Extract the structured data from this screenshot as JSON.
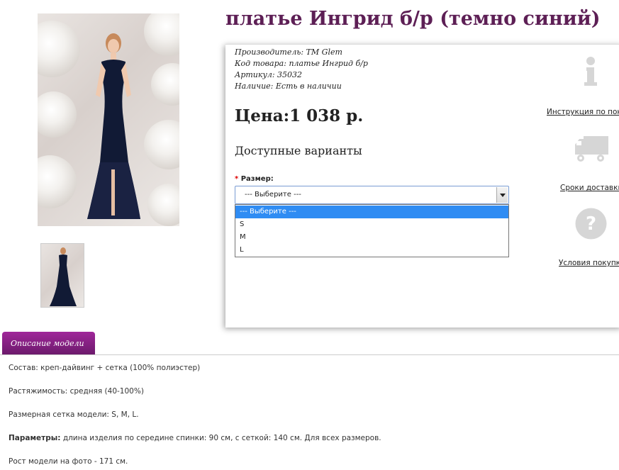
{
  "product": {
    "title": "платье Ингрид б/р (темно синий)"
  },
  "specs": {
    "manufacturer_label": "Производитель:",
    "manufacturer_value": "TM Glem",
    "code_label": "Код товара:",
    "code_value": "платье Ингрид б/р",
    "sku_label": "Артикул:",
    "sku_value": "35032",
    "availability_label": "Наличие:",
    "availability_value": "Есть в наличии"
  },
  "price": {
    "label": "Цена:",
    "value": "1 038 р."
  },
  "variants": {
    "title": "Доступные варианты",
    "required_mark": "*",
    "size_label": "Размер:",
    "selected": "--- Выберите ---",
    "options": [
      "--- Выберите ---",
      "S",
      "M",
      "L"
    ]
  },
  "side_links": {
    "instructions": "Инструкция по покупке",
    "delivery": "Сроки доставки",
    "conditions": "Условия покупки"
  },
  "tabs": {
    "description": "Описание модели"
  },
  "description": {
    "composition_label": "Состав:",
    "composition_value": "креп-дайвинг + сетка (100% полиэстер)",
    "stretch_label": "Растяжимость:",
    "stretch_value": "средняя (40-100%)",
    "sizes_label": "Размерная сетка модели:",
    "sizes_value": "S, M, L.",
    "params_label": "Параметры:",
    "params_value": "длина изделия по середине спинки:  90 см, с сеткой: 140 см. Для всех размеров.",
    "model_height": "Рост модели на фото - 171 см."
  },
  "colors": {
    "title": "#5d1f55",
    "tab": "#8a2286",
    "dropdown_highlight": "#2f8cf3",
    "icon_gray": "#d6d6d6"
  },
  "icons": {
    "instructions": "info-icon",
    "delivery": "truck-icon",
    "conditions": "question-icon"
  }
}
